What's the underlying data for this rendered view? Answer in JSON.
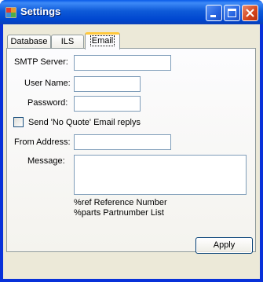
{
  "window": {
    "title": "Settings"
  },
  "tabs": [
    {
      "label": "Database"
    },
    {
      "label": "ILS"
    },
    {
      "label": "Email"
    }
  ],
  "email": {
    "smtp_label": "SMTP Server:",
    "smtp_value": "",
    "username_label": "User Name:",
    "username_value": "",
    "password_label": "Password:",
    "password_value": "",
    "no_quote_label": "Send 'No Quote' Email replys",
    "no_quote_checked": false,
    "from_label": "From Address:",
    "from_value": "",
    "message_label": "Message:",
    "message_value": "",
    "hint_ref": "%ref Reference Number",
    "hint_parts": "%parts Partnumber List"
  },
  "apply_label": "Apply",
  "icons": {
    "app": "settings-app-icon",
    "minimize": "minimize-icon",
    "maximize": "maximize-icon",
    "close": "close-icon"
  },
  "colors": {
    "titlebar": "#0a5be8",
    "close": "#d3431b",
    "face": "#ece9d8",
    "active_tab_highlight": "#ffc83c"
  }
}
